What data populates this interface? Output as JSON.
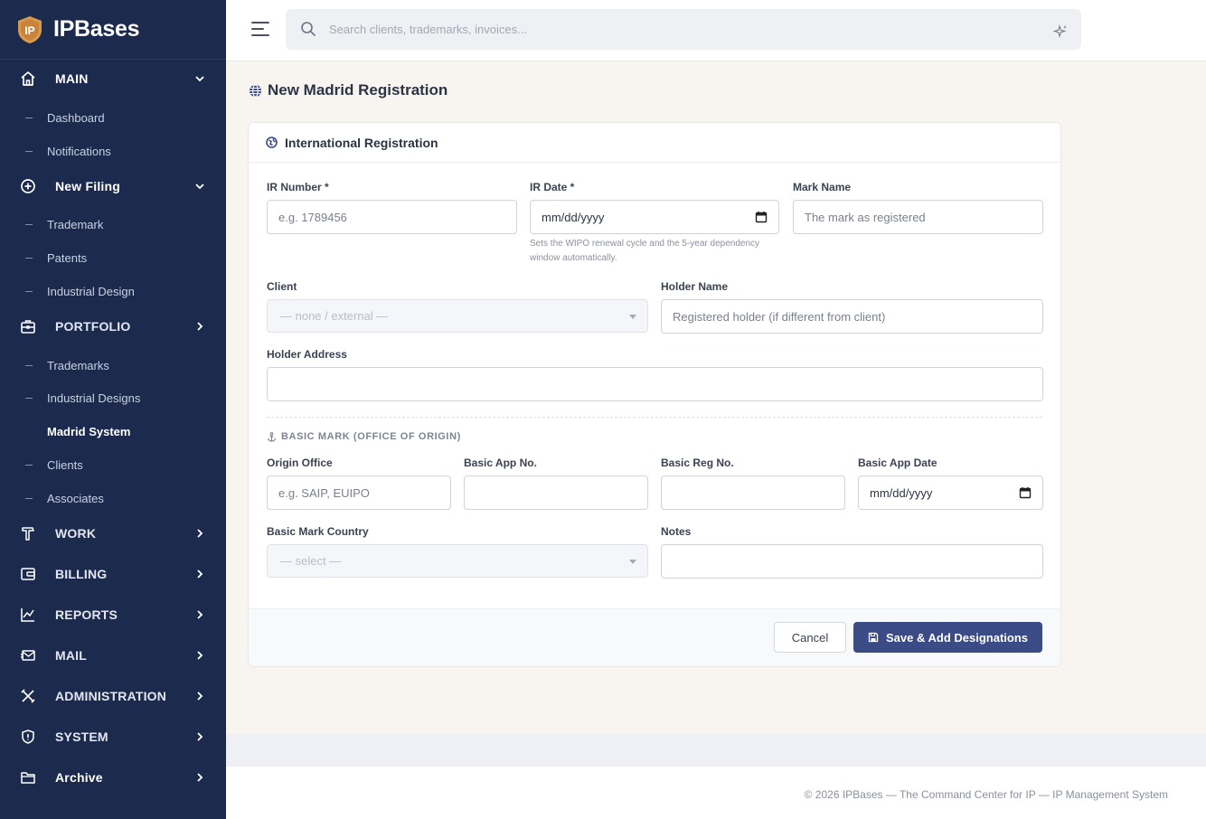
{
  "brand": {
    "logo_text": "IP",
    "name": "IPBases"
  },
  "sidebar": {
    "sections": [
      {
        "label": "MAIN",
        "icon": "home-icon",
        "expanded": true,
        "subitems": [
          "Dashboard",
          "Notifications"
        ]
      },
      {
        "label": "New Filing",
        "icon": "plus-circle-icon",
        "expanded": true,
        "subitems": [
          "Trademark",
          "Patents",
          "Industrial Design"
        ]
      },
      {
        "label": "PORTFOLIO",
        "icon": "briefcase-icon",
        "expanded": false,
        "subitems": [
          "Trademarks",
          "Industrial Designs",
          "Madrid System",
          "Clients",
          "Associates"
        ]
      },
      {
        "label": "WORK",
        "icon": "hammer-icon",
        "expanded": false
      },
      {
        "label": "BILLING",
        "icon": "wallet-icon",
        "expanded": false
      },
      {
        "label": "REPORTS",
        "icon": "chart-line-icon",
        "expanded": false
      },
      {
        "label": "MAIL",
        "icon": "mail-icon",
        "expanded": false
      },
      {
        "label": "ADMINISTRATION",
        "icon": "tools-icon",
        "expanded": false
      },
      {
        "label": "SYSTEM",
        "icon": "shield-icon",
        "expanded": false
      },
      {
        "label": "Archive",
        "icon": "folder-icon",
        "expanded": false
      }
    ],
    "active_item": "Madrid System"
  },
  "search": {
    "placeholder": "Search clients, trademarks, invoices..."
  },
  "page": {
    "title": "New Madrid Registration"
  },
  "card": {
    "title": "International Registration",
    "fields": {
      "ir_number": {
        "label": "IR Number *",
        "placeholder": "e.g. 1789456"
      },
      "ir_date": {
        "label": "IR Date *",
        "value": "mm/dd/yyyy",
        "hint": "Sets the WIPO renewal cycle and the 5-year dependency window automatically."
      },
      "mark_name": {
        "label": "Mark Name",
        "placeholder": "The mark as registered"
      },
      "client": {
        "label": "Client",
        "value": "— none / external —"
      },
      "holder_name": {
        "label": "Holder Name",
        "placeholder": "Registered holder (if different from client)"
      },
      "holder_address": {
        "label": "Holder Address",
        "placeholder": ""
      },
      "basic_section": "BASIC MARK (OFFICE OF ORIGIN)",
      "origin_office": {
        "label": "Origin Office",
        "placeholder": "e.g. SAIP, EUIPO"
      },
      "basic_app_no": {
        "label": "Basic App No.",
        "placeholder": ""
      },
      "basic_reg_no": {
        "label": "Basic Reg No.",
        "placeholder": ""
      },
      "basic_app_date": {
        "label": "Basic App Date",
        "value": "mm/dd/yyyy"
      },
      "basic_mark_country": {
        "label": "Basic Mark Country",
        "value": "— select —"
      },
      "notes": {
        "label": "Notes",
        "placeholder": ""
      }
    },
    "buttons": {
      "cancel": "Cancel",
      "save": "Save & Add Designations"
    }
  },
  "footer": {
    "text": "© 2026 IPBases — The Command Center for IP — IP Management System"
  },
  "colors": {
    "sidebar_bg": "#1c2a4d",
    "primary_button": "#3b4b85",
    "brand_orange": "#d99a4e"
  }
}
